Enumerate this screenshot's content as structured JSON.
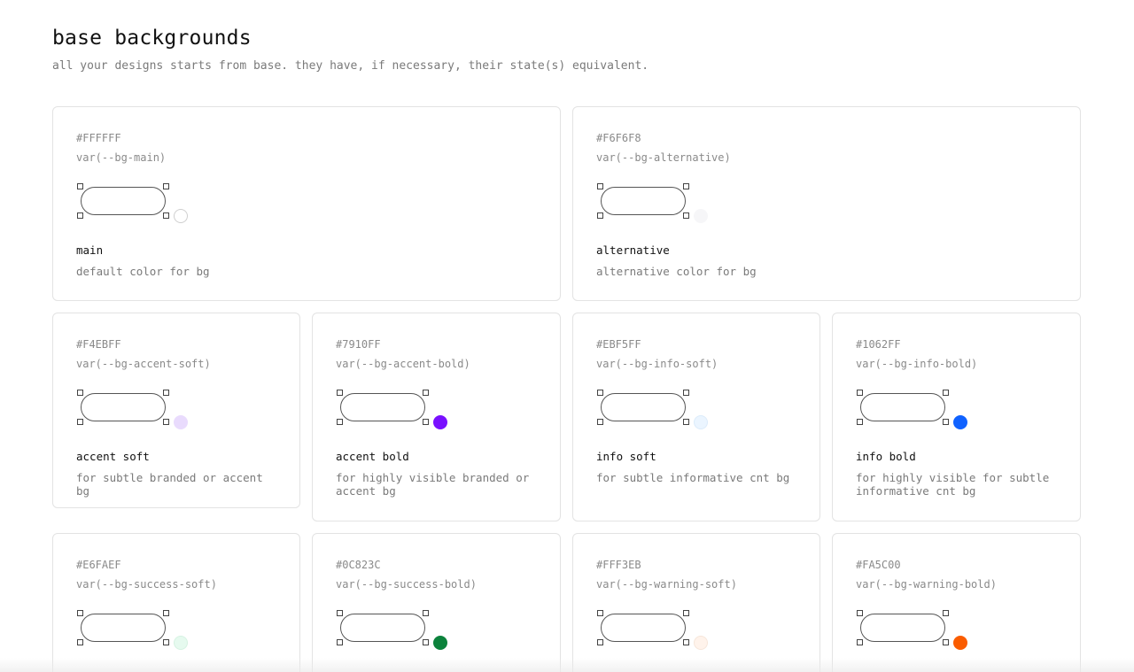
{
  "header": {
    "title": "base backgrounds",
    "subtitle": "all your designs starts from base. they have, if necessary, their state(s) equivalent."
  },
  "cards": [
    {
      "hex": "#FFFFFF",
      "var": "var(--bg-main)",
      "name": "main",
      "desc": "default color for bg",
      "swatch": "#FFFFFF",
      "swatch_border": "#cfcfcf"
    },
    {
      "hex": "#F6F6F8",
      "var": "var(--bg-alternative)",
      "name": "alternative",
      "desc": "alternative color for bg",
      "swatch": "#F6F6F8",
      "swatch_border": "#F6F6F8"
    },
    {
      "hex": "#F4EBFF",
      "var": "var(--bg-accent-soft)",
      "name": "accent soft",
      "desc": "for subtle branded or accent bg",
      "swatch": "#E9DBFD",
      "swatch_border": "#E9DBFD"
    },
    {
      "hex": "#7910FF",
      "var": "var(--bg-accent-bold)",
      "name": "accent bold",
      "desc": "for highly visible branded or accent bg",
      "swatch": "#7910FF",
      "swatch_border": "#7910FF"
    },
    {
      "hex": "#EBF5FF",
      "var": "var(--bg-info-soft)",
      "name": "info soft",
      "desc": "for subtle informative cnt bg",
      "swatch": "#EBF5FF",
      "swatch_border": "#DCEBFA"
    },
    {
      "hex": "#1062FF",
      "var": "var(--bg-info-bold)",
      "name": "info bold",
      "desc": "for highly visible for subtle informative cnt bg",
      "swatch": "#1062FF",
      "swatch_border": "#1062FF"
    },
    {
      "hex": "#E6FAEF",
      "var": "var(--bg-success-soft)",
      "name": "",
      "desc": "",
      "swatch": "#E6FAEF",
      "swatch_border": "#D6F2E2"
    },
    {
      "hex": "#0C823C",
      "var": "var(--bg-success-bold)",
      "name": "",
      "desc": "",
      "swatch": "#0C823C",
      "swatch_border": "#0C823C"
    },
    {
      "hex": "#FFF3EB",
      "var": "var(--bg-warning-soft)",
      "name": "",
      "desc": "",
      "swatch": "#FFF3EB",
      "swatch_border": "#F6E6DA"
    },
    {
      "hex": "#FA5C00",
      "var": "var(--bg-warning-bold)",
      "name": "",
      "desc": "",
      "swatch": "#FA5C00",
      "swatch_border": "#FA5C00"
    }
  ]
}
